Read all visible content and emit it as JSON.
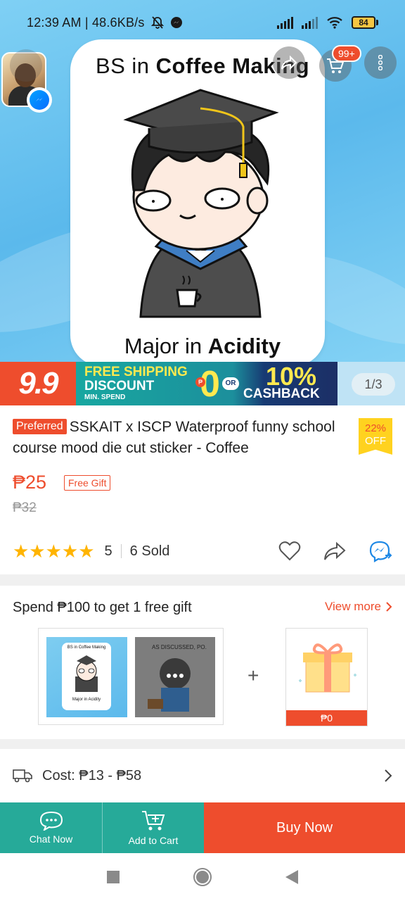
{
  "status_bar": {
    "time": "12:39 AM",
    "net_speed": "48.6KB/s",
    "battery": "84",
    "icons": [
      "mute-icon",
      "messenger-icon",
      "signal-icon",
      "signal-icon",
      "wifi-icon",
      "battery-icon"
    ]
  },
  "header": {
    "cart_badge": "99+",
    "buttons": [
      "back-icon",
      "share-icon",
      "cart-icon",
      "more-icon"
    ]
  },
  "gallery": {
    "sticker_title_prefix": "BS in ",
    "sticker_title_bold": "Coffee Making",
    "sticker_foot_prefix": "Major in ",
    "sticker_foot_bold": "Acidity",
    "counter": "1/3"
  },
  "promo_banner": {
    "sale_label": "9.9",
    "free_shipping": "FREE SHIPPING",
    "discount": "DISCOUNT",
    "min_spend": "MIN. SPEND",
    "zero": "0",
    "or": "OR",
    "pct": "10%",
    "cashback": "CASHBACK"
  },
  "product": {
    "preferred_tag": "Preferred",
    "title": "SSKAIT x ISCP Waterproof funny school course mood die cut sticker - Coffee",
    "discount_pct": "22%",
    "discount_off": "OFF",
    "price": "₱25",
    "free_gift_tag": "Free Gift",
    "old_price": "₱32",
    "rating": "5",
    "stars": "★★★★★",
    "sold": "6 Sold"
  },
  "gift_section": {
    "heading": "Spend ₱100 to get 1 free gift",
    "view_more": "View more",
    "thumb1_title": "BS in Coffee Making",
    "thumb1_foot": "Major in Acidity",
    "thumb2_text": "AS DISCUSSED, PO.",
    "plus": "+",
    "gift_price": "₱0"
  },
  "shipping": {
    "cost": "Cost: ₱13 - ₱58"
  },
  "action_bar": {
    "chat": "Chat Now",
    "cart": "Add to Cart",
    "buy": "Buy Now"
  },
  "colors": {
    "brand": "#ee4d2d",
    "teal": "#26aa99",
    "star": "#ffb400"
  }
}
